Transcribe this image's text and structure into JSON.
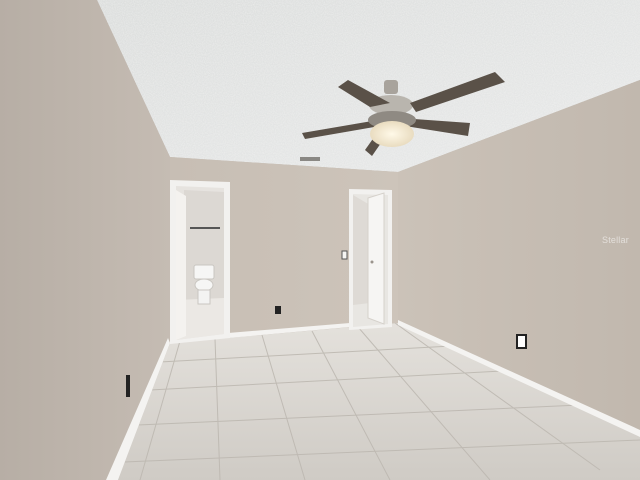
{
  "watermark": "Stellar"
}
